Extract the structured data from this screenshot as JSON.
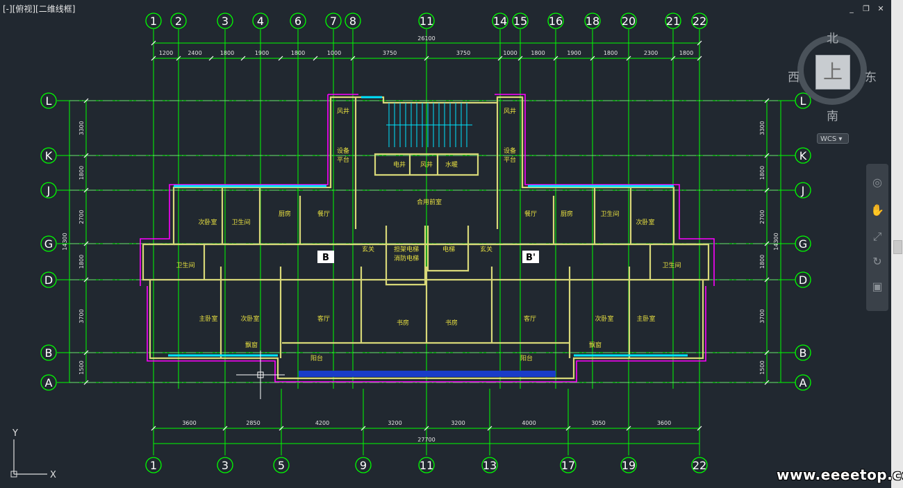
{
  "viewport": {
    "label": "[-][俯视][二维线框]"
  },
  "window_controls": {
    "minimize": "_",
    "restore": "❐",
    "close": "✕"
  },
  "viewcube": {
    "north": "北",
    "south": "南",
    "east": "东",
    "west": "西",
    "face": "上",
    "wcs": "WCS"
  },
  "watermark": "www.eeeetop.com",
  "ucs": {
    "y": "Y",
    "x": "X"
  },
  "colors": {
    "background": "#212830",
    "axis": "#00ff00",
    "wall": "#d8d878",
    "room": "#e8e040",
    "dim": "#e6e6e6",
    "magenta": "#ff00ff",
    "cyan": "#00e5ff"
  },
  "drawing": {
    "top_axes": [
      "1",
      "2",
      "3",
      "4",
      "6",
      "7",
      "8",
      "11",
      "14",
      "15",
      "16",
      "18",
      "20",
      "21",
      "22"
    ],
    "bottom_axes": [
      "1",
      "3",
      "5",
      "9",
      "11",
      "13",
      "17",
      "19",
      "22"
    ],
    "row_axes": [
      "L",
      "K",
      "J",
      "G",
      "D",
      "B",
      "A"
    ],
    "top_total": "26100",
    "top_dims": [
      "1200",
      "2400",
      "1800",
      "1900",
      "1800",
      "1000",
      "3750",
      "3750",
      "1000",
      "1800",
      "1900",
      "1800",
      "2300",
      "1800"
    ],
    "bottom_total": "27700",
    "bottom_dims": [
      "3600",
      "2850",
      "4200",
      "3200",
      "3200",
      "4000",
      "3050",
      "3600"
    ],
    "side_total": "14300",
    "side_dims": [
      "3300",
      "1800",
      "2700",
      "1800",
      "3700",
      "1500"
    ],
    "unit_labels": [
      "B",
      "B'"
    ],
    "rooms": [
      {
        "id": "fengjing-l",
        "text": "风井"
      },
      {
        "id": "fengjing-r",
        "text": "风井"
      },
      {
        "id": "shebei-l1",
        "text": "设备"
      },
      {
        "id": "shebei-l2",
        "text": "平台"
      },
      {
        "id": "shebei-r1",
        "text": "设备"
      },
      {
        "id": "shebei-r2",
        "text": "平台"
      },
      {
        "id": "dianjing",
        "text": "电井"
      },
      {
        "id": "fengjing-c",
        "text": "风井"
      },
      {
        "id": "shuinuan",
        "text": "水暖"
      },
      {
        "id": "hefu-qianshi",
        "text": "合用前室"
      },
      {
        "id": "ciwoshi-nl",
        "text": "次卧室"
      },
      {
        "id": "weishengjian-nl",
        "text": "卫生间"
      },
      {
        "id": "chufang-l",
        "text": "厨房"
      },
      {
        "id": "canting-l",
        "text": "餐厅"
      },
      {
        "id": "canting-r",
        "text": "餐厅"
      },
      {
        "id": "chufang-r",
        "text": "厨房"
      },
      {
        "id": "weishengjian-nr",
        "text": "卫生间"
      },
      {
        "id": "ciwoshi-nr",
        "text": "次卧室"
      },
      {
        "id": "xuanguan-l",
        "text": "玄关"
      },
      {
        "id": "danjia-1",
        "text": "担架电梯"
      },
      {
        "id": "danjia-2",
        "text": "消防电梯"
      },
      {
        "id": "dianti",
        "text": "电梯"
      },
      {
        "id": "xuanguan-r",
        "text": "玄关"
      },
      {
        "id": "weishengjian-sl",
        "text": "卫生间"
      },
      {
        "id": "weishengjian-sr",
        "text": "卫生间"
      },
      {
        "id": "zhuwoshi-l",
        "text": "主卧室"
      },
      {
        "id": "ciwoshi-sl",
        "text": "次卧室"
      },
      {
        "id": "keting-l",
        "text": "客厅"
      },
      {
        "id": "shufang-l",
        "text": "书房"
      },
      {
        "id": "shufang-r",
        "text": "书房"
      },
      {
        "id": "keting-r",
        "text": "客厅"
      },
      {
        "id": "ciwoshi-sr",
        "text": "次卧室"
      },
      {
        "id": "zhuwoshi-r",
        "text": "主卧室"
      },
      {
        "id": "piaochuang-l",
        "text": "飘窗"
      },
      {
        "id": "piaochuang-r",
        "text": "飘窗"
      },
      {
        "id": "yangtai-l",
        "text": "阳台"
      },
      {
        "id": "yangtai-r",
        "text": "阳台"
      }
    ]
  }
}
